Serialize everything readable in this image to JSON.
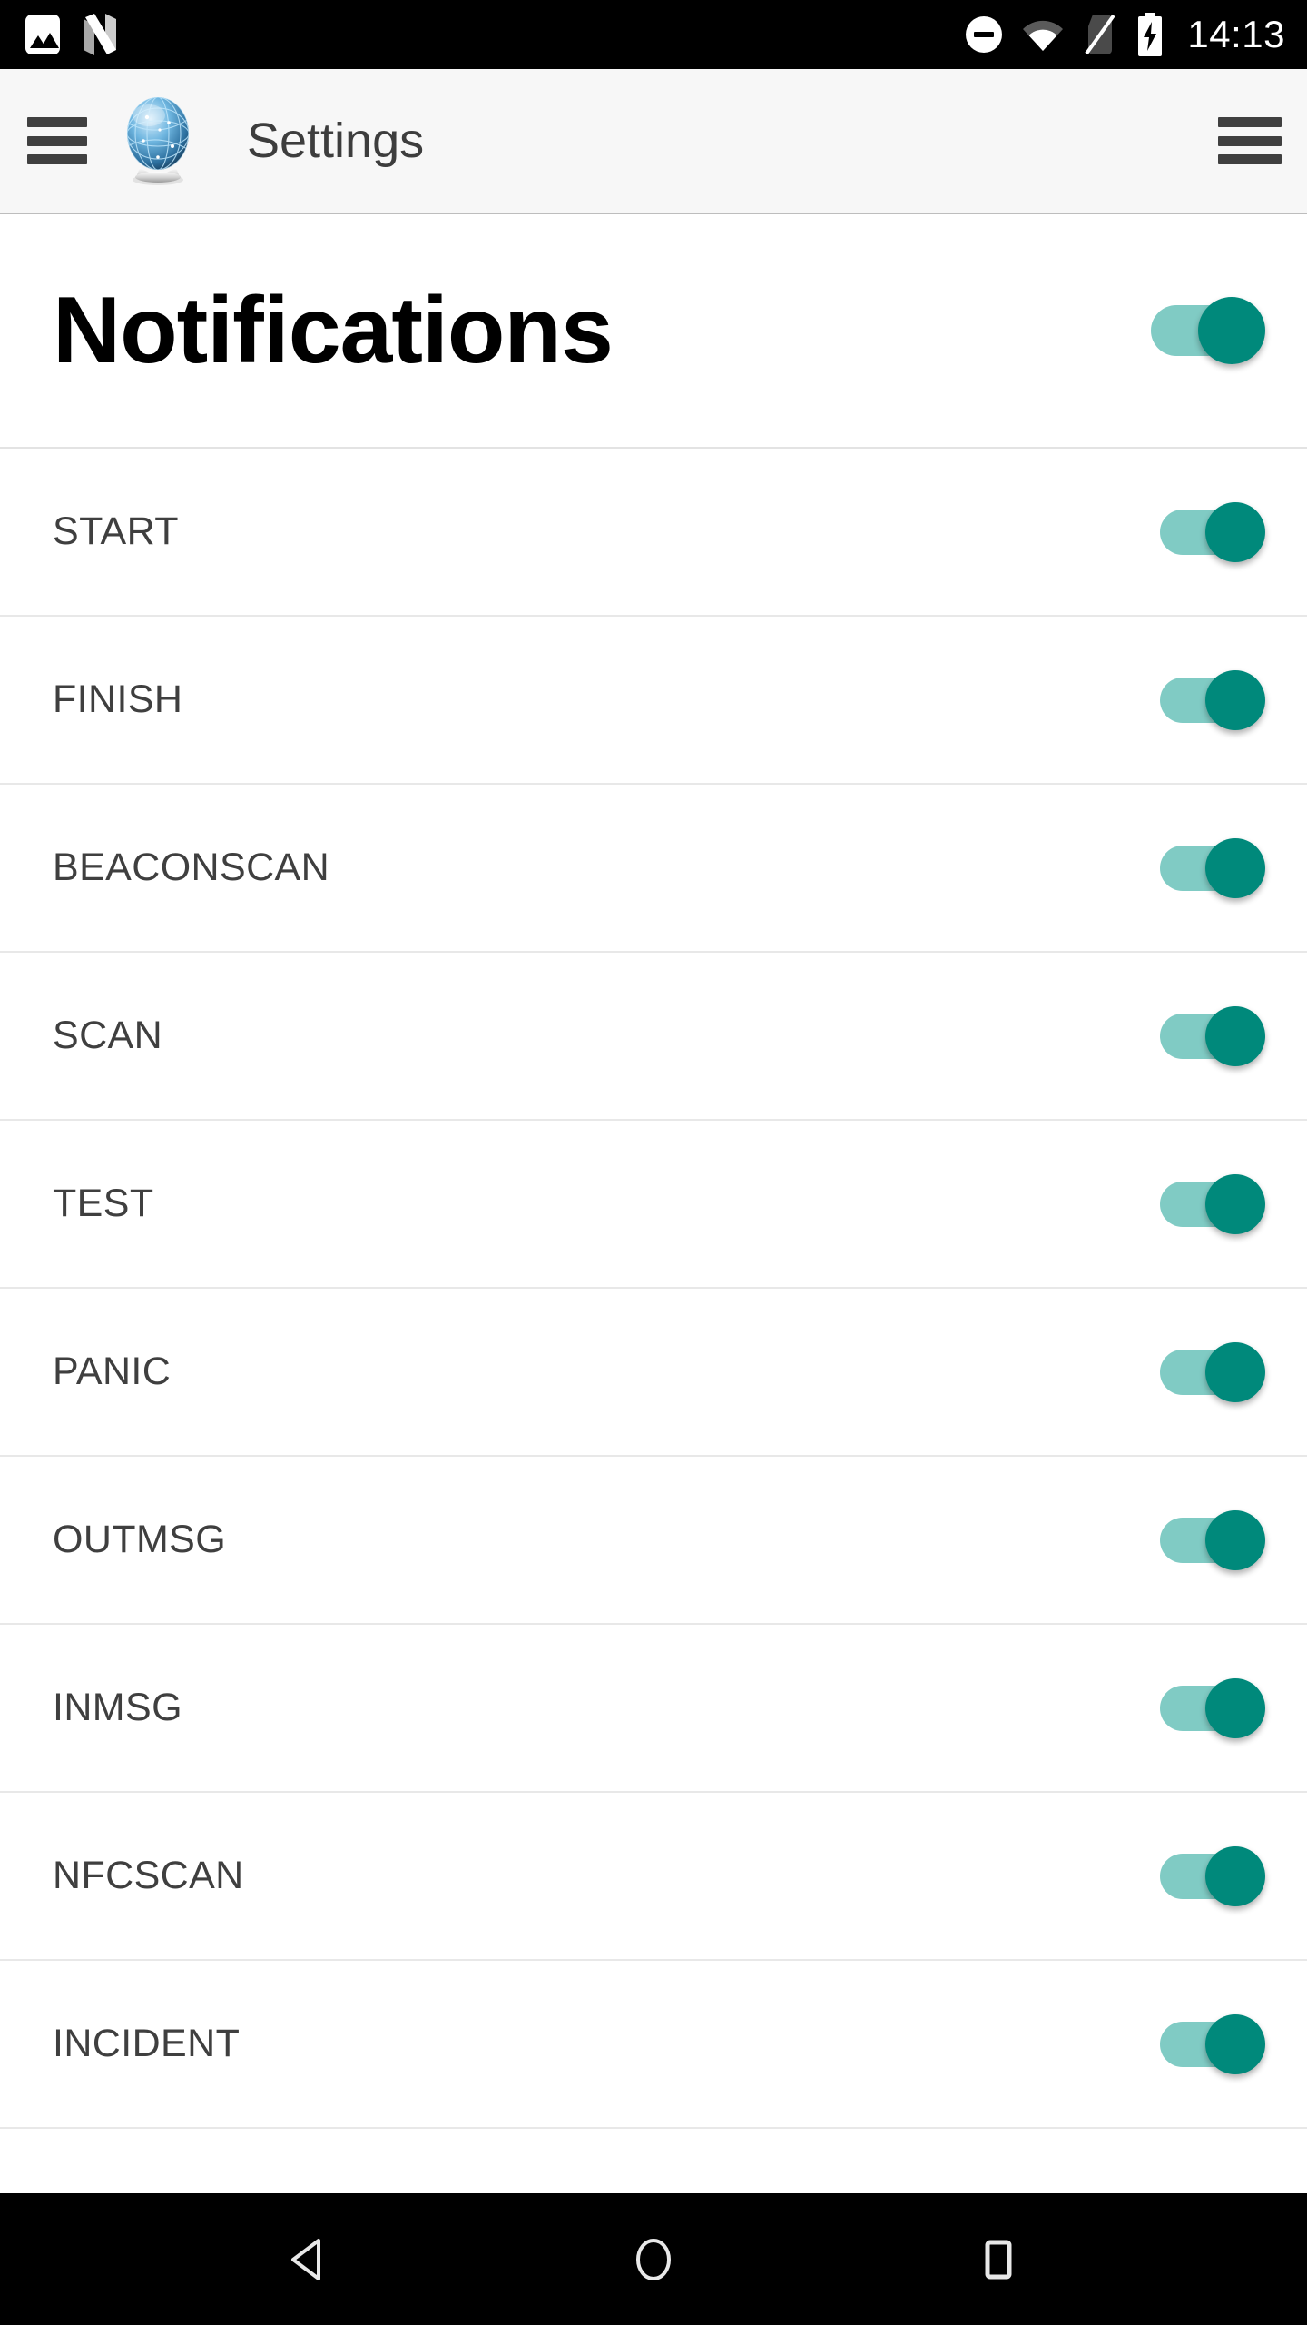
{
  "status_bar": {
    "left_icons": [
      "screenshot-icon",
      "android-nougat-icon"
    ],
    "right_icons": [
      "do-not-disturb-icon",
      "wifi-icon",
      "no-sim-icon",
      "battery-charging-icon"
    ],
    "time": "14:13",
    "background_color": "#000000"
  },
  "app_bar": {
    "menu_icon": "hamburger-menu-icon",
    "logo_icon": "globe-sphere-logo",
    "title": "Settings",
    "overflow_icon": "overflow-menu-icon",
    "background_color": "#f7f7f7"
  },
  "section": {
    "title": "Notifications",
    "toggle_on": true
  },
  "theme": {
    "switch_track_color": "#80cbc4",
    "switch_thumb_color": "#00897b",
    "text_color": "#3f3f3f",
    "divider_color": "#e8e8e8"
  },
  "rows": [
    {
      "label": "START",
      "toggle_on": true
    },
    {
      "label": "FINISH",
      "toggle_on": true
    },
    {
      "label": "BEACONSCAN",
      "toggle_on": true
    },
    {
      "label": "SCAN",
      "toggle_on": true
    },
    {
      "label": "TEST",
      "toggle_on": true
    },
    {
      "label": "PANIC",
      "toggle_on": true
    },
    {
      "label": "OUTMSG",
      "toggle_on": true
    },
    {
      "label": "INMSG",
      "toggle_on": true
    },
    {
      "label": "NFCSCAN",
      "toggle_on": true
    },
    {
      "label": "INCIDENT",
      "toggle_on": true
    }
  ],
  "nav_bar": {
    "buttons": [
      "back-button",
      "home-button",
      "recents-button"
    ],
    "background_color": "#000000"
  }
}
